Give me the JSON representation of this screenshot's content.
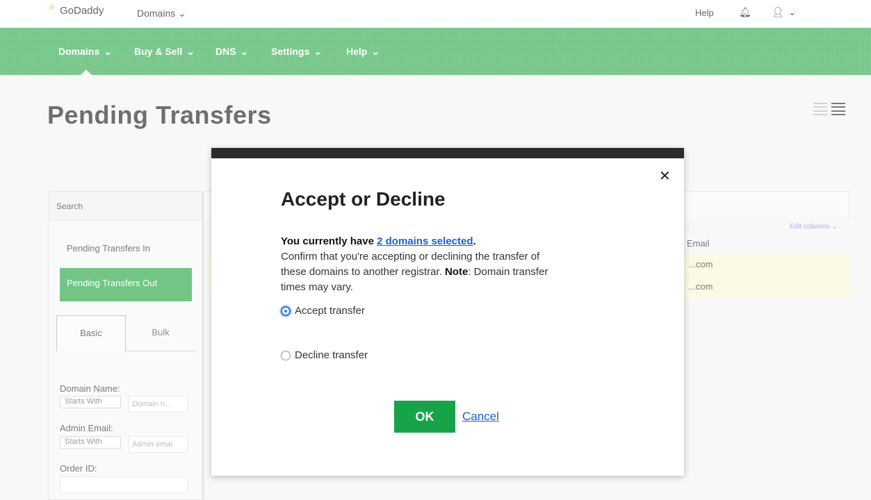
{
  "topbar": {
    "logo_text": "GoDaddy",
    "domains_menu": "Domains",
    "help": "Help"
  },
  "nav": {
    "items": [
      {
        "label": "Domains"
      },
      {
        "label": "Buy & Sell"
      },
      {
        "label": "DNS"
      },
      {
        "label": "Settings"
      },
      {
        "label": "Help"
      }
    ]
  },
  "page": {
    "title": "Pending Transfers"
  },
  "sidebar": {
    "search_heading": "Search",
    "link_in": "Pending Transfers In",
    "link_out": "Pending Transfers Out",
    "tab_basic": "Basic",
    "tab_bulk": "Bulk",
    "domain_name_label": "Domain Name:",
    "domain_name_select": "Starts With",
    "domain_name_placeholder": "Domain n...",
    "admin_email_label": "Admin Email:",
    "admin_email_select": "Starts With",
    "admin_email_placeholder": "Admin emai",
    "order_id_label": "Order ID:"
  },
  "table": {
    "edit_columns": "Edit columns",
    "email_header": "Email",
    "rows": [
      {
        "email": "...com"
      },
      {
        "email": "...com"
      }
    ]
  },
  "modal": {
    "title": "Accept or Decline",
    "intro_prefix": "You currently have ",
    "selected_link": "2 domains selected",
    "intro_suffix": ".",
    "body_text": "Confirm that you're accepting or declining the transfer of these domains to another registrar.",
    "note_label": "Note",
    "note_text": ": Domain transfer times may vary.",
    "option_accept": "Accept transfer",
    "option_decline": "Decline transfer",
    "selected_option": "accept",
    "ok_label": "OK",
    "cancel_label": "Cancel"
  },
  "colors": {
    "brand_green": "#28a745",
    "ok_green": "#17a34a",
    "link_blue": "#1f5fc8"
  }
}
